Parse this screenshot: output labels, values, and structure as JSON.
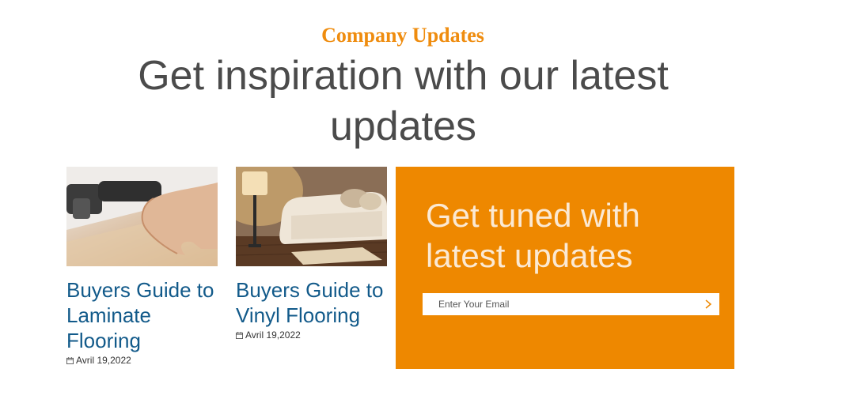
{
  "section": {
    "eyebrow": "Company Updates",
    "headline": "Get inspiration with our latest updates"
  },
  "posts": [
    {
      "title": "Buyers Guide to Laminate Flooring",
      "date": "Avril 19,2022",
      "image": "laminate-floor-hand-photo"
    },
    {
      "title": "Buyers Guide to Vinyl Flooring",
      "date": "Avril 19,2022",
      "image": "sofa-living-room-photo"
    }
  ],
  "newsletter": {
    "title": "Get tuned with latest updates",
    "placeholder": "Enter Your Email",
    "submit_icon": "chevron-right-icon"
  },
  "colors": {
    "accent": "#ee8800",
    "link": "#125a8a",
    "heading": "#4b4b4b"
  }
}
